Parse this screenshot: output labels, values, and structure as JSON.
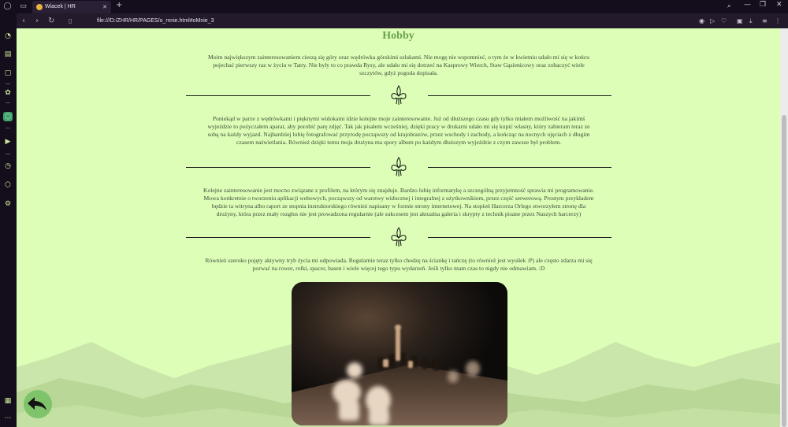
{
  "browser": {
    "tab_title": "Wiacek | HR",
    "tab_close": "✕",
    "new_tab": "+",
    "url": "file:///D:/ZHR/HR/PAGES/o_mnie.html#oMnie_3",
    "nav": {
      "back": "‹",
      "forward": "›",
      "reload": "↻"
    },
    "window_controls": {
      "minimize": "—",
      "restore": "❐",
      "close": "✕"
    }
  },
  "page": {
    "heading": "Hobby",
    "paragraphs": [
      "Moim największym zainteresowaniem cieszą się góry oraz wędrówka górskimi szlakami. Nie mogę nie wspomnieć, o tym że w kwietniu udało mi się w końcu pojechać pierwszy raz w życiu w Tatry. Nie były to co prawda Rysy, ale udało mi się dotrzeć na Kasprowy Wierch, Staw Gąsienicowy oraz zobaczyć wiele szczytów, gdyż pogoda dopisała.",
      "Poniekąd w parze z wędrówkami i pięknymi widokami idzie kolejne moje zainteresowanie. Już od dłuższego czasu gdy tylko miałem możliwość na jakimś wyjeździe to pożyczałem aparat, aby porobić parę zdjęć. Tak jak pisałem wcześniej, dzięki pracy w drukarni udało mi się kupić własny, który zabieram teraz ze sobą na każdy wyjazd. Najbardziej lubię fotografować przyrodę począwszy od krajobrazów, przez wschody i zachody, a kończąc na nocnych ujęciach z długim czasem naświetlania. Również dzięki temu moja drużyna ma spory album po każdym dłuższym wyjeździe z czym zawsze był problem.",
      "Kolejne zainteresowanie jest mocno związane z profilem, na którym się znajduje. Bardzo lubię informatykę a szczególną przyjemność sprawia mi programowanie. Mowa konkretnie o tworzeniu aplikacji webowych, począwszy od warstwy widocznej i integralnej z użytkownikiem, przez część serwerową. Prostym przykładem będzie ta witryna albo raport ze stopnia instruktorskiego również napisany w formie strony internetowej. Na stopień Harcerza Orlego stworzyłem stronę dla drużyny, która przez mały rozgłos nie jest prowadzona regularnie (ale sukcesem jest aktualna galeria i skrypty z technik pisane przez Naszych harcerzy)",
      "Również szeroko pojęty aktywny tryb życia mi odpowiada. Regularnie teraz tylko chodzę na ściankę i tańczę (to również jest wysiłek :P) ale często zdarza mi się porwać na rower, rolki, spacer, basen i wiele więcej tego typu wydarzeń. Jeśli tylko mam czas to nigdy nie odmawiam. :D"
    ],
    "paragraph_lines": [
      [
        "Moim największym zainteresowaniem cieszą się góry oraz wędrówka górskimi szlakami. Nie mogę nie wspomnieć, o tym że w kwietniu udało mi się w końcu",
        "pojechać pierwszy raz w życiu w Tatry. Nie były to co prawda Rysy, ale udało mi się dotrzeć na Kasprowy Wierch, Staw Gąsienicowy oraz zobaczyć wiele",
        "szczytów, gdyż pogoda dopisała."
      ],
      [
        "Poniekąd w parze z wędrówkami i pięknymi widokami idzie kolejne moje zainteresowanie. Już od dłuższego czasu gdy tylko miałem możliwość na jakimś",
        "wyjeździe to pożyczałem aparat, aby porobić parę zdjęć. Tak jak pisałem wcześniej, dzięki pracy w drukarni udało mi się kupić własny, który zabieram teraz ze",
        "sobą na każdy wyjazd. Najbardziej lubię fotografować przyrodę począwszy od krajobrazów, przez wschody i zachody, a kończąc na nocnych ujęciach z długim",
        "czasem naświetlania. Również dzięki temu moja drużyna ma spory album po każdym dłuższym wyjeździe z czym zawsze był problem."
      ],
      [
        "Kolejne zainteresowanie jest mocno związane z profilem, na którym się znajduje. Bardzo lubię informatykę a szczególną przyjemność sprawia mi programowanie.",
        "Mowa konkretnie o tworzeniu aplikacji webowych, począwszy od warstwy widocznej i integralnej z użytkownikiem, przez część serwerową. Prostym przykładem",
        "będzie ta witryna albo raport ze stopnia instruktorskiego również napisany w formie strony internetowej. Na stopień Harcerza Orlego stworzyłem stronę dla",
        "drużyny, która przez mały rozgłos nie jest prowadzona regularnie (ale sukcesem jest aktualna galeria i skrypty z technik pisane przez Naszych harcerzy)"
      ],
      [
        "Również szeroko pojęty aktywny tryb życia mi odpowiada. Regularnie teraz tylko chodzę na ściankę i tańczę (to również jest wysiłek :P) ale często zdarza mi się",
        "porwać na rower, rolki, spacer, basen i wiele więcej tego typu wydarzeń. Jeśli tylko mam czas to nigdy nie odmawiam. :D"
      ]
    ]
  },
  "colors": {
    "page_bg": "#dcfeb6",
    "heading": "#6aa14b",
    "text": "#3d4a3a",
    "hills_light": "#c8e3a7",
    "hills_dark": "#b5d494",
    "browser_bg": "#140d1c"
  },
  "icons": {
    "sidebar": [
      "opera-logo-icon",
      "speed-dial-icon",
      "shopping-bag-icon",
      "twitch-icon",
      "chatgpt-icon",
      "whatsapp-icon",
      "music-player-icon",
      "history-icon",
      "extensions-box-icon",
      "settings-gear-icon",
      "pinboard-icon",
      "more-icon"
    ],
    "toolbar": [
      "camera-icon",
      "send-icon",
      "heart-icon",
      "wallet-icon",
      "download-icon",
      "menu-icon"
    ],
    "back_button": "arrow-back-icon",
    "divider": "fleur-de-lis-icon"
  }
}
